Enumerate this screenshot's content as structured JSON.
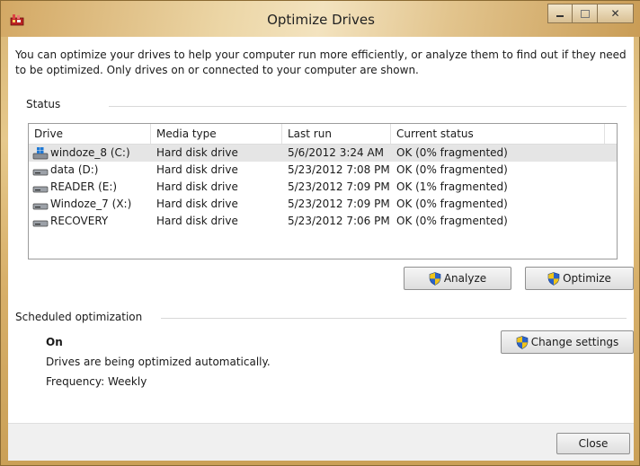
{
  "window": {
    "title": "Optimize Drives"
  },
  "description": "You can optimize your drives to help your computer run more efficiently, or analyze them to find out if they need to be optimized. Only drives on or connected to your computer are shown.",
  "status": {
    "label": "Status",
    "columns": [
      "Drive",
      "Media type",
      "Last run",
      "Current status"
    ],
    "rows": [
      {
        "drive": "windoze_8 (C:)",
        "media": "Hard disk drive",
        "last_run": "5/6/2012 3:24 AM",
        "status": "OK (0% fragmented)",
        "icon": "windows-drive-icon"
      },
      {
        "drive": "data (D:)",
        "media": "Hard disk drive",
        "last_run": "5/23/2012 7:08 PM",
        "status": "OK (0% fragmented)",
        "icon": "hard-drive-icon"
      },
      {
        "drive": "READER (E:)",
        "media": "Hard disk drive",
        "last_run": "5/23/2012 7:09 PM",
        "status": "OK (1% fragmented)",
        "icon": "hard-drive-icon"
      },
      {
        "drive": "Windoze_7 (X:)",
        "media": "Hard disk drive",
        "last_run": "5/23/2012 7:09 PM",
        "status": "OK (0% fragmented)",
        "icon": "hard-drive-icon"
      },
      {
        "drive": "RECOVERY",
        "media": "Hard disk drive",
        "last_run": "5/23/2012 7:06 PM",
        "status": "OK (0% fragmented)",
        "icon": "hard-drive-icon"
      }
    ],
    "analyze_label": "Analyze",
    "optimize_label": "Optimize"
  },
  "scheduled": {
    "label": "Scheduled optimization",
    "state": "On",
    "detail": "Drives are being optimized automatically.",
    "frequency": "Frequency: Weekly",
    "change_label": "Change settings"
  },
  "close_label": "Close",
  "colors": {
    "frame": "#d9b574",
    "selected_row": "#e5e5e5",
    "shield_blue": "#2a62c9",
    "shield_yellow": "#f0c419"
  }
}
